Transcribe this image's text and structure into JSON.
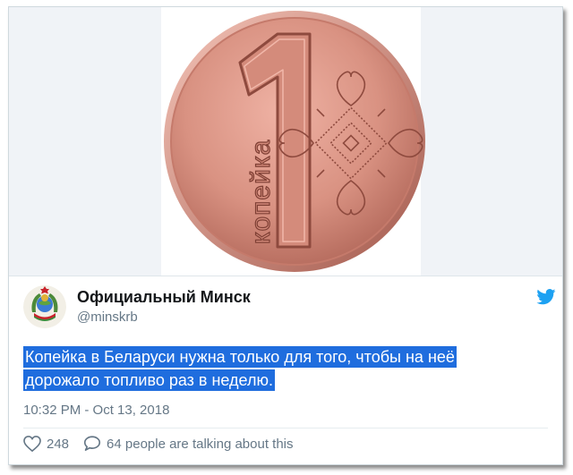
{
  "media": {
    "coin_denomination": "1",
    "coin_word": "копейка"
  },
  "author": {
    "display_name": "Официальный Минск",
    "handle": "@minskrb",
    "avatar_icon": "belarus-coat-of-arms-icon"
  },
  "tweet": {
    "text_line1": "Копейка в Беларуси нужна только для того, чтобы на неё",
    "text_line2": "дорожало топливо раз в неделю.",
    "highlight_color": "#1f6dde",
    "timestamp": "10:32 PM - Oct 13, 2018"
  },
  "actions": {
    "like_count": "248",
    "reply_text": "64 people are talking about this"
  },
  "colors": {
    "twitter_blue": "#1da1f2",
    "coin": "#d99282"
  }
}
